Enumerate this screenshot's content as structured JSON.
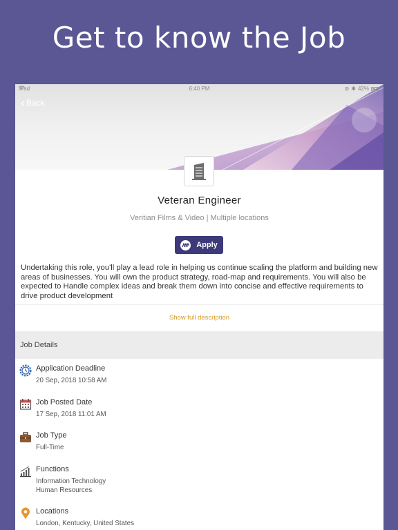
{
  "promo": {
    "title": "Get to know the Job"
  },
  "statusbar": {
    "device": "iPad",
    "time": "6:40 PM",
    "battery": "42%"
  },
  "nav": {
    "back_label": "Back"
  },
  "job": {
    "title": "Veteran Engineer",
    "company_location": "Veritian Films & Video | Multiple locations",
    "apply_label": "Apply",
    "description": "Undertaking this role, you'll play a lead role in helping us continue scaling the platform and building new areas of businesses. You will own the product strategy, road-map and requirements. You will also be expected to Handle complex ideas and break them down into concise and effective requirements to drive product development",
    "show_full_label": "Show full description"
  },
  "details": {
    "header": "Job Details",
    "items": [
      {
        "icon": "clock-gear-icon",
        "label": "Application Deadline",
        "values": [
          "20 Sep, 2018 10:58 AM"
        ]
      },
      {
        "icon": "calendar-icon",
        "label": "Job Posted Date",
        "values": [
          "17 Sep, 2018 11:01 AM"
        ]
      },
      {
        "icon": "briefcase-icon",
        "label": "Job Type",
        "values": [
          "Full-Time"
        ]
      },
      {
        "icon": "bar-chart-icon",
        "label": "Functions",
        "values": [
          "Information Technology",
          "Human Resources"
        ]
      },
      {
        "icon": "location-pin-icon",
        "label": "Locations",
        "values": [
          "London, Kentucky, United States"
        ]
      }
    ]
  },
  "colors": {
    "background": "#5b5694",
    "apply": "#3e3a7a",
    "link": "#d79a22"
  }
}
